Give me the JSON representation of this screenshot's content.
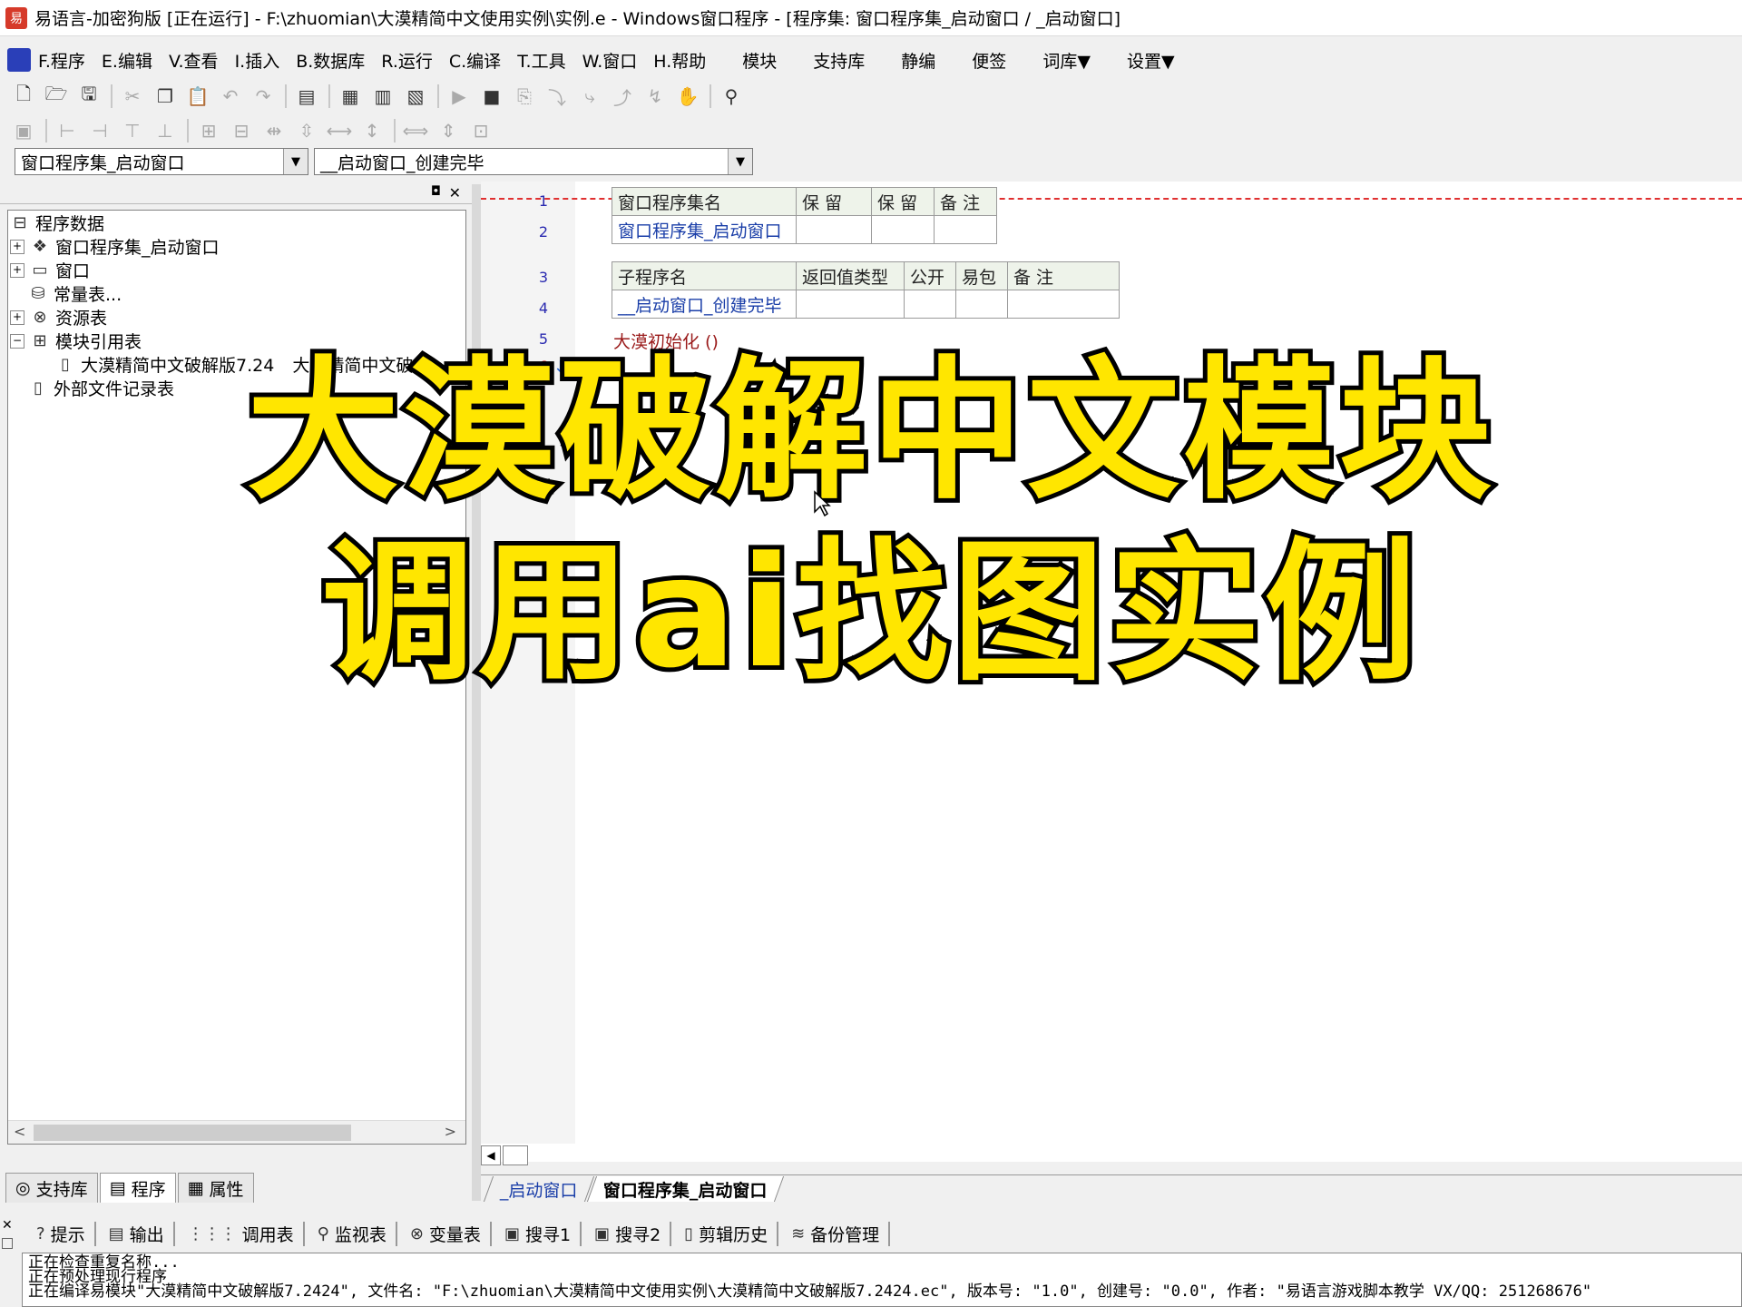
{
  "window": {
    "title": "易语言-加密狗版 [正在运行] - F:\\zhuomian\\大漠精简中文使用实例\\实例.e - Windows窗口程序 - [程序集: 窗口程序集_启动窗口 / _启动窗口]"
  },
  "menu": {
    "items": [
      "F.程序",
      "E.编辑",
      "V.查看",
      "I.插入",
      "B.数据库",
      "R.运行",
      "C.编译",
      "T.工具",
      "W.窗口",
      "H.帮助"
    ],
    "extra": [
      "模块",
      "支持库",
      "静编",
      "便签",
      "词库▼",
      "设置▼"
    ]
  },
  "selectors": {
    "left": "窗口程序集_启动窗口",
    "right": "__启动窗口_创建完毕"
  },
  "tree": {
    "root": "程序数据",
    "items": [
      "窗口程序集_启动窗口",
      "窗口",
      "常量表...",
      "资源表",
      "模块引用表"
    ],
    "module_child": "大漠精简中文破解版7.24",
    "module_child_2": "大漠精简中文破",
    "external": "外部文件记录表"
  },
  "left_tabs": [
    "支持库",
    "程序",
    "属性"
  ],
  "editor": {
    "line_numbers": [
      "1",
      "2",
      "3",
      "4",
      "5",
      "6"
    ],
    "table1": {
      "headers": [
        "窗口程序集名",
        "保 留",
        "保 留",
        "备 注"
      ],
      "row": [
        "窗口程序集_启动窗口",
        "",
        "",
        ""
      ]
    },
    "table2": {
      "headers": [
        "子程序名",
        "返回值类型",
        "公开",
        "易包",
        "备 注"
      ],
      "row": [
        "__启动窗口_创建完毕",
        "",
        "",
        "",
        ""
      ]
    },
    "code_line": "大漠初始化 ()"
  },
  "editor_tabs": [
    "_启动窗口",
    "窗口程序集_启动窗口"
  ],
  "bottom_tabs": [
    "提示",
    "输出",
    "调用表",
    "监视表",
    "变量表",
    "搜寻1",
    "搜寻2",
    "剪辑历史",
    "备份管理"
  ],
  "output": {
    "lines": [
      "正在检查重复名称...",
      "正在预处理现行程序",
      "正在编译易模块\"大漠精简中文破解版7.2424\", 文件名: \"F:\\zhuomian\\大漠精简中文使用实例\\大漠精简中文破解版7.2424.ec\", 版本号: \"1.0\", 创建号: \"0.0\", 作者: \"易语言游戏脚本教学 VX/QQ: 251268676\""
    ]
  },
  "overlay": {
    "line1": "大漠破解中文模块",
    "line2": "调用ai找图实例"
  }
}
